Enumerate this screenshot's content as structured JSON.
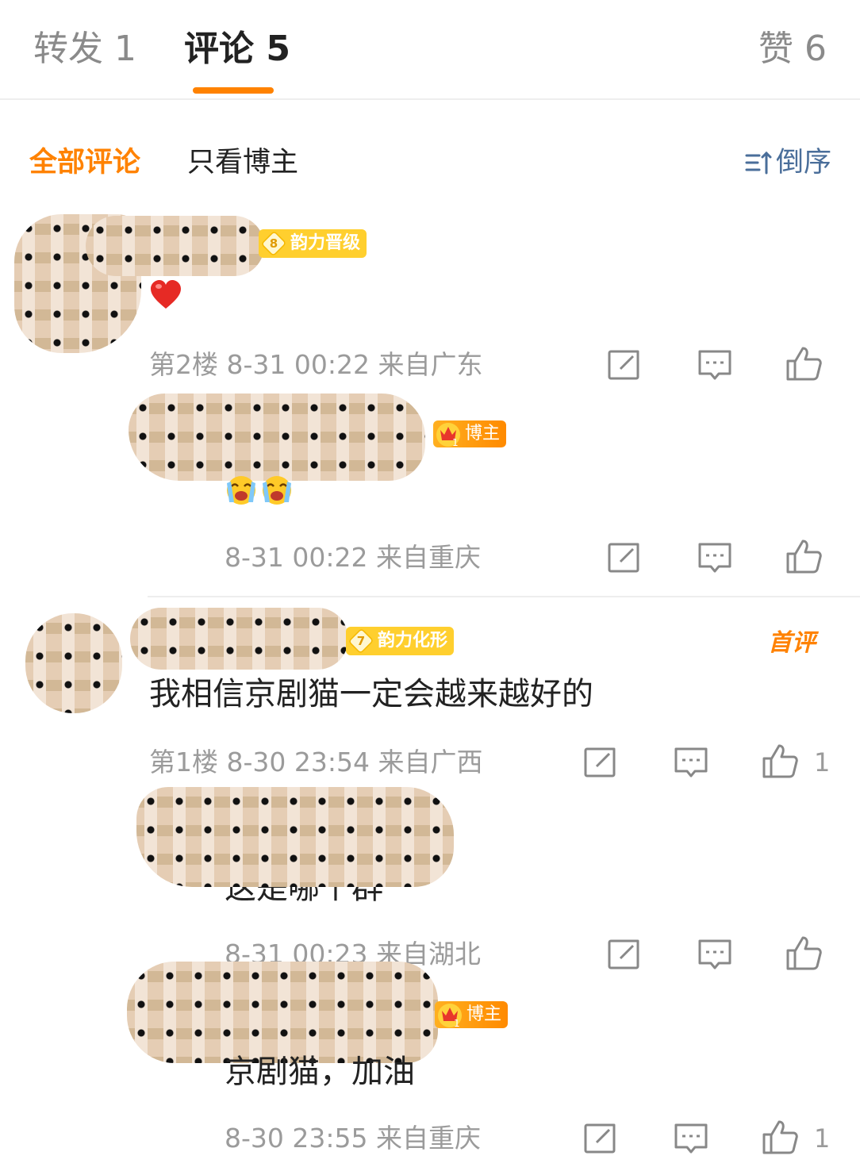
{
  "tabs": {
    "repost": "转发 1",
    "comments": "评论 5",
    "likes": "赞 6"
  },
  "filters": {
    "all": "全部评论",
    "blogger_only": "只看博主",
    "sort": "倒序"
  },
  "comments": [
    {
      "badge_level": "8",
      "badge_text": "韵力晋级",
      "content_emoji": "red-heart",
      "meta": "第2楼 8-31 00:22 来自广东",
      "like_count": "",
      "replies": [
        {
          "author_badge": "博主",
          "content_emoji": "crying-laughing x2",
          "meta": "8-31 00:22 来自重庆"
        }
      ]
    },
    {
      "badge_level": "7",
      "badge_text": "韵力化形",
      "first_tag": "首评",
      "content": "我相信京剧猫一定会越来越好的",
      "meta": "第1楼 8-30 23:54 来自广西",
      "like_count": "1",
      "replies": [
        {
          "content": "这是哪个群",
          "meta": "8-31 00:23 来自湖北",
          "like_count": ""
        },
        {
          "author_badge": "博主",
          "content": "京剧猫，加油",
          "meta": "8-30 23:55 来自重庆",
          "like_count": "1"
        }
      ]
    }
  ],
  "colors": {
    "accent": "#ff8200",
    "sort_blue": "#4a6e9a",
    "badge_yellow": "#ffcf2e"
  }
}
